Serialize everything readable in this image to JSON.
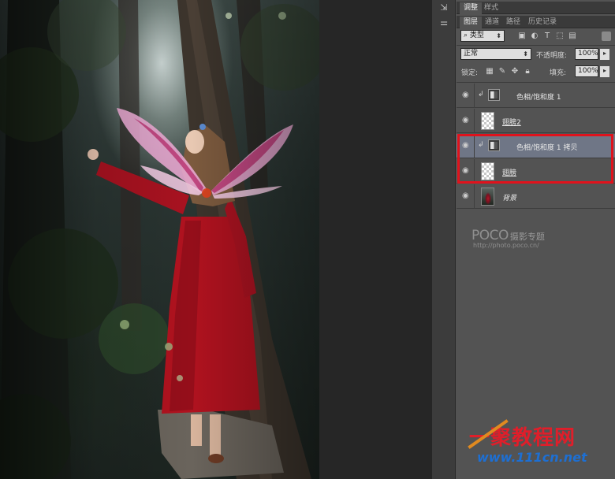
{
  "top_tabs": [
    "调整",
    "样式"
  ],
  "layer_tabs": [
    "图层",
    "通道",
    "路径",
    "历史记录"
  ],
  "filter": {
    "label": "类型",
    "icons": [
      "image-filter-icon",
      "adjustment-filter-icon",
      "type-filter-icon",
      "shape-filter-icon",
      "smart-object-filter-icon"
    ]
  },
  "blend": {
    "mode": "正常",
    "opacity_label": "不透明度:",
    "opacity": "100%"
  },
  "lock": {
    "label": "锁定:",
    "fill_label": "填充:",
    "fill": "100%"
  },
  "layers": [
    {
      "name": "色相/饱和度 1",
      "type": "adjustment",
      "clipped": true,
      "selected": false
    },
    {
      "name": "翅膀2",
      "type": "pixel",
      "clipped": false,
      "selected": false
    },
    {
      "name": "色相/饱和度 1 拷贝",
      "type": "adjustment",
      "clipped": true,
      "selected": true
    },
    {
      "name": "翅膀",
      "type": "pixel",
      "clipped": false,
      "selected": false
    },
    {
      "name": "背景",
      "type": "background",
      "clipped": false,
      "selected": false
    }
  ],
  "watermark_poco": {
    "brand": "POCO",
    "label": "摄影专题",
    "url": "http://photo.poco.cn/"
  },
  "watermark_site": {
    "title": "一聚教程网",
    "url": "www.111cn.net"
  },
  "colors": {
    "highlight": "#e0121c",
    "selected_layer": "#6f7686",
    "dress": "#b0121f"
  }
}
